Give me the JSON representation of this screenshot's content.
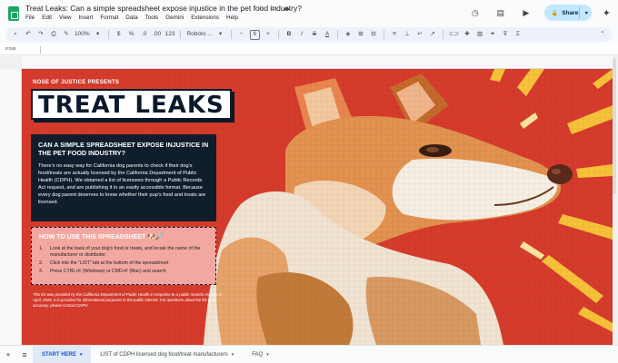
{
  "title_bar": {
    "doc_title": "Treat Leaks: Can a simple spreadsheet expose injustice in the pet food industry?",
    "star_icon": "star-icon",
    "move_icon": "folder-icon",
    "cloud_icon": "cloud-icon"
  },
  "menus": [
    "File",
    "Edit",
    "View",
    "Insert",
    "Format",
    "Data",
    "Tools",
    "Gemini",
    "Extensions",
    "Help"
  ],
  "top_right": {
    "share_label": "Share"
  },
  "toolbar": {
    "zoom": "100%",
    "currency": "$",
    "percent": "%",
    "decrease_decimal": ".0",
    "increase_decimal": ".00",
    "number_format": "123",
    "font": "Roboto ...",
    "font_size": "6",
    "bold": "B",
    "italic": "I",
    "strikethrough": "S",
    "text_color": "A"
  },
  "formula_bar": {
    "name_box": "IF345"
  },
  "poster": {
    "presents": "NOSE OF JUSTICE PRESENTS",
    "headline": "TREAT LEAKS",
    "question": "CAN A SIMPLE SPREADSHEET EXPOSE INJUSTICE IN THE PET FOOD INDUSTRY?",
    "intro": "There’s no easy way for California dog parents to check if their dog’s food/treats are actually licensed by the California Department of Public Health (CDPH). We obtained a list of licensees through a Public Records Act request, and are publishing it in an easily accessible format. Because every dog parent deserves to know whether their pup’s food and treats are licensed.",
    "howto_title": "HOW TO USE THIS SPREADSHEET 🐶🔎",
    "steps": [
      {
        "num": "1.",
        "text": "Look at the back of your dog’s food or treats, and locate the name of the manufacturer or distributor."
      },
      {
        "num": "2.",
        "text": "Click into the “LIST” tab at the bottom of the spreadsheet"
      },
      {
        "num": "3.",
        "text": "Press CTRL+F (Windows) or CMD+F (Mac) and search"
      }
    ],
    "disclaimer": "This list was provided by the California Department of Public Health in response to a public records request in April, 2026. It is provided for informational purposes in the public interest. For questions about the list or its accuracy, please contact CDPH."
  },
  "tabs": {
    "add_icon": "plus-icon",
    "all_sheets_icon": "menu-icon",
    "items": [
      {
        "label": "START HERE",
        "active": true
      },
      {
        "label": "LIST of CDPH licensed dog food/treat manufacturers",
        "active": false
      },
      {
        "label": "FAQ",
        "active": false
      }
    ]
  }
}
